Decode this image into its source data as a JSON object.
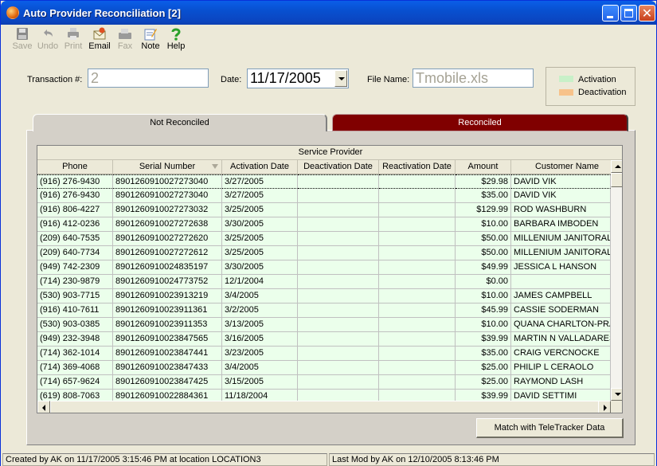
{
  "window": {
    "title": "Auto Provider Reconciliation [2]"
  },
  "toolbar": [
    {
      "label": "Save",
      "icon": "save-icon",
      "enabled": false
    },
    {
      "label": "Undo",
      "icon": "undo-icon",
      "enabled": false
    },
    {
      "label": "Print",
      "icon": "print-icon",
      "enabled": false
    },
    {
      "label": "Email",
      "icon": "email-icon",
      "enabled": true
    },
    {
      "label": "Fax",
      "icon": "fax-icon",
      "enabled": false
    },
    {
      "label": "Note",
      "icon": "note-icon",
      "enabled": true
    },
    {
      "label": "Help",
      "icon": "help-icon",
      "enabled": true
    }
  ],
  "form": {
    "transaction_label": "Transaction #:",
    "transaction_value": "2",
    "date_label": "Date:",
    "date_value": "11/17/2005",
    "filename_label": "File Name:",
    "filename_value": "Tmobile.xls"
  },
  "legend": {
    "activation_label": "Activation",
    "activation_color": "#c8f0c8",
    "deactivation_label": "Deactivation",
    "deactivation_color": "#f7c28a"
  },
  "tabs": {
    "not_reconciled": "Not Reconciled",
    "reconciled": "Reconciled",
    "reconciled_color": "#800000"
  },
  "grid": {
    "group_header": "Service Provider",
    "columns": [
      "Phone",
      "Serial Number",
      "Activation Date",
      "Deactivation Date",
      "Reactivation Date",
      "Amount",
      "Customer Name"
    ],
    "row_color": "#ebffeb",
    "rows": [
      [
        "(916) 276-9430",
        "8901260910027273040",
        "3/27/2005",
        "",
        "",
        "$29.98",
        "DAVID VIK"
      ],
      [
        "(916) 276-9430",
        "8901260910027273040",
        "3/27/2005",
        "",
        "",
        "$35.00",
        "DAVID VIK"
      ],
      [
        "(916) 806-4227",
        "8901260910027273032",
        "3/25/2005",
        "",
        "",
        "$129.99",
        "ROD WASHBURN"
      ],
      [
        "(916) 412-0236",
        "8901260910027272638",
        "3/30/2005",
        "",
        "",
        "$10.00",
        "BARBARA IMBODEN"
      ],
      [
        "(209) 640-7535",
        "8901260910027272620",
        "3/25/2005",
        "",
        "",
        "$50.00",
        "MILLENIUM JANITORAL"
      ],
      [
        "(209) 640-7734",
        "8901260910027272612",
        "3/25/2005",
        "",
        "",
        "$50.00",
        "MILLENIUM JANITORAL"
      ],
      [
        "(949) 742-2309",
        "8901260910024835197",
        "3/30/2005",
        "",
        "",
        "$49.99",
        "JESSICA L HANSON"
      ],
      [
        "(714) 230-9879",
        "8901260910024773752",
        "12/1/2004",
        "",
        "",
        "$0.00",
        ""
      ],
      [
        "(530) 903-7715",
        "8901260910023913219",
        "3/4/2005",
        "",
        "",
        "$10.00",
        "JAMES CAMPBELL"
      ],
      [
        "(916) 410-7611",
        "8901260910023911361",
        "3/2/2005",
        "",
        "",
        "$45.99",
        "CASSIE SODERMAN"
      ],
      [
        "(530) 903-0385",
        "8901260910023911353",
        "3/13/2005",
        "",
        "",
        "$10.00",
        "QUANA CHARLTON-PRA"
      ],
      [
        "(949) 232-3948",
        "8901260910023847565",
        "3/16/2005",
        "",
        "",
        "$39.99",
        "MARTIN N VALLADARES"
      ],
      [
        "(714) 362-1014",
        "8901260910023847441",
        "3/23/2005",
        "",
        "",
        "$35.00",
        "CRAIG VERCNOCKE"
      ],
      [
        "(714) 369-4068",
        "8901260910023847433",
        "3/4/2005",
        "",
        "",
        "$25.00",
        "PHILIP L CERAOLO"
      ],
      [
        "(714) 657-9624",
        "8901260910023847425",
        "3/15/2005",
        "",
        "",
        "$25.00",
        "RAYMOND LASH"
      ],
      [
        "(619) 808-7063",
        "8901260910022884361",
        "11/18/2004",
        "",
        "",
        "$39.99",
        "DAVID SETTIMI"
      ]
    ]
  },
  "actions": {
    "match_button": "Match with TeleTracker Data"
  },
  "status": {
    "created": "Created by AK on 11/17/2005 3:15:46 PM at location LOCATION3",
    "modified": "Last Mod by AK on 12/10/2005 8:13:46 PM"
  }
}
